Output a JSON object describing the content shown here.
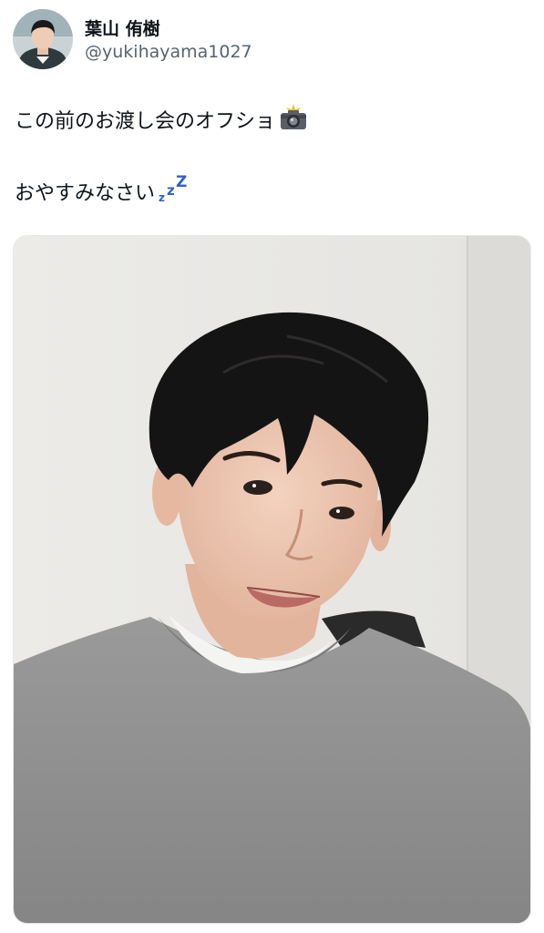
{
  "post": {
    "author": {
      "display_name": "葉山 侑樹",
      "handle": "@yukihayama1027",
      "avatar_icon": "avatar-photo"
    },
    "text_line1": "この前のお渡し会のオフショ",
    "text_line1_emoji": "camera-with-flash-icon",
    "text_line2": "おやすみなさい",
    "text_line2_emoji": "zzz-icon",
    "media": {
      "type": "photo",
      "subject": "selfie-photo"
    }
  }
}
